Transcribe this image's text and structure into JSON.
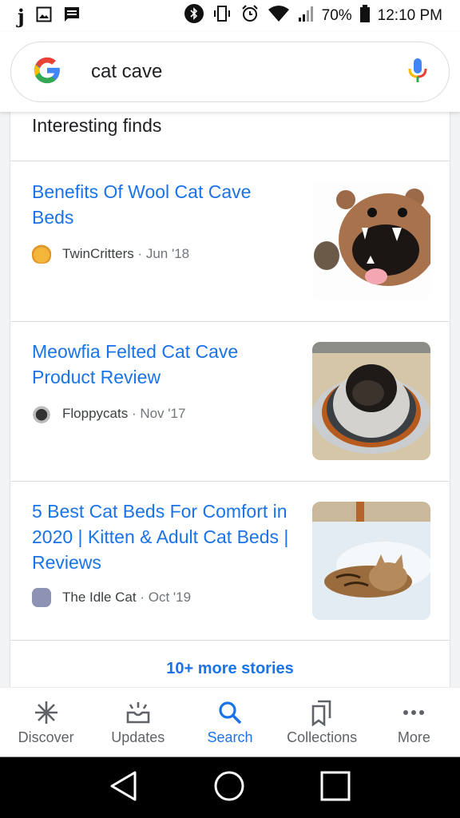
{
  "status_bar": {
    "left_icons": [
      "j-app-icon",
      "image-icon",
      "message-icon"
    ],
    "right_icons": [
      "bluetooth-icon",
      "vibrate-icon",
      "alarm-icon",
      "wifi-icon",
      "signal-icon"
    ],
    "battery": "70%",
    "time": "12:10 PM"
  },
  "search": {
    "query": "cat cave",
    "logo": "google-logo",
    "mic": "mic-icon"
  },
  "section": {
    "title": "Interesting finds"
  },
  "stories": [
    {
      "title": "Benefits Of Wool Cat Cave Beds",
      "source": "TwinCritters",
      "date": "· Jun '18",
      "thumbnail": "hippo-shaped felt cat cave with kitten"
    },
    {
      "title": "Meowfia Felted Cat Cave Product Review",
      "source": "Floppycats",
      "date": "· Nov '17",
      "thumbnail": "striped felted cat cave with cat inside"
    },
    {
      "title": "5 Best Cat Beds For Comfort in 2020 | Kitten & Adult Cat Beds | Reviews",
      "source": "The Idle Cat",
      "date": "· Oct '19",
      "thumbnail": "bengal cat sleeping on white blanket"
    }
  ],
  "more_stories": "10+ more stories",
  "bottom_nav": [
    {
      "label": "Discover",
      "icon": "asterisk-icon",
      "active": false
    },
    {
      "label": "Updates",
      "icon": "updates-tray-icon",
      "active": false
    },
    {
      "label": "Search",
      "icon": "search-icon",
      "active": true
    },
    {
      "label": "Collections",
      "icon": "bookmark-icon",
      "active": false
    },
    {
      "label": "More",
      "icon": "more-dots-icon",
      "active": false
    }
  ],
  "colors": {
    "link_blue": "#1a73e8",
    "text_dark": "#202124",
    "text_gray": "#70757a"
  }
}
